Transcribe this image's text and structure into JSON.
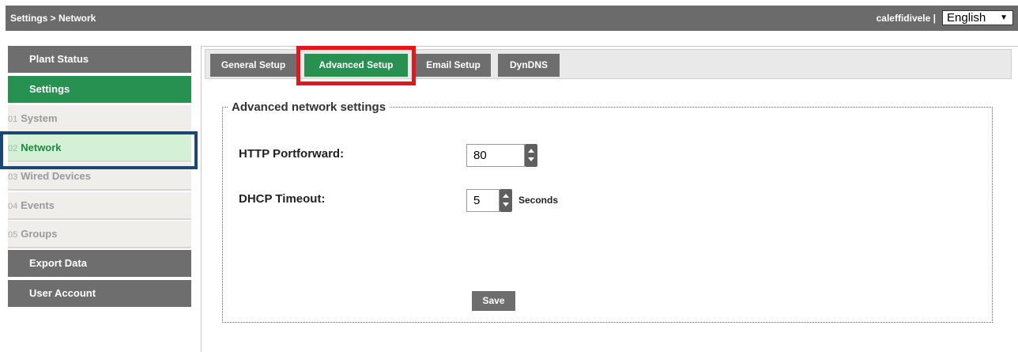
{
  "header": {
    "breadcrumb": "Settings > Network",
    "user": "caleffidivele |",
    "language": "English"
  },
  "sidebar": {
    "items": [
      {
        "label": "Plant Status"
      },
      {
        "label": "Settings"
      }
    ],
    "sub_items": [
      {
        "num": "01",
        "label": "System"
      },
      {
        "num": "02",
        "label": "Network"
      },
      {
        "num": "03",
        "label": "Wired Devices"
      },
      {
        "num": "04",
        "label": "Events"
      },
      {
        "num": "05",
        "label": "Groups"
      }
    ],
    "bottom_items": [
      {
        "label": "Export Data"
      },
      {
        "label": "User Account"
      }
    ]
  },
  "tabs": [
    {
      "label": "General Setup"
    },
    {
      "label": "Advanced Setup"
    },
    {
      "label": "Email Setup"
    },
    {
      "label": "DynDNS"
    }
  ],
  "form": {
    "legend": "Advanced network settings",
    "http_label": "HTTP Portforward:",
    "http_value": "80",
    "dhcp_label": "DHCP Timeout:",
    "dhcp_value": "5",
    "dhcp_unit": "Seconds",
    "save_label": "Save"
  },
  "colors": {
    "active_green": "#279152",
    "header_gray": "#6b6b6b",
    "highlight_red": "#e8141b",
    "selection_blue": "#1c4773"
  }
}
